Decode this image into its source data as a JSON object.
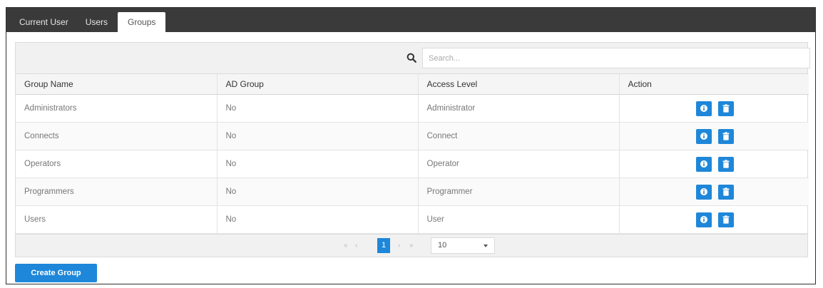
{
  "tabs": [
    {
      "label": "Current User",
      "active": false
    },
    {
      "label": "Users",
      "active": false
    },
    {
      "label": "Groups",
      "active": true
    }
  ],
  "search": {
    "placeholder": "Search...",
    "value": ""
  },
  "table": {
    "columns": [
      "Group Name",
      "AD Group",
      "Access Level",
      "Action"
    ],
    "rows": [
      {
        "group_name": "Administrators",
        "ad_group": "No",
        "access_level": "Administrator"
      },
      {
        "group_name": "Connects",
        "ad_group": "No",
        "access_level": "Connect"
      },
      {
        "group_name": "Operators",
        "ad_group": "No",
        "access_level": "Operator"
      },
      {
        "group_name": "Programmers",
        "ad_group": "No",
        "access_level": "Programmer"
      },
      {
        "group_name": "Users",
        "ad_group": "No",
        "access_level": "User"
      }
    ]
  },
  "pagination": {
    "first_symbol": "«",
    "prev_symbol": "‹",
    "current_page": "1",
    "next_symbol": "›",
    "last_symbol": "»",
    "page_size": "10"
  },
  "create_button": {
    "label": "Create Group"
  },
  "colors": {
    "accent": "#1e87d9",
    "tabbar": "#3a3a3a"
  }
}
